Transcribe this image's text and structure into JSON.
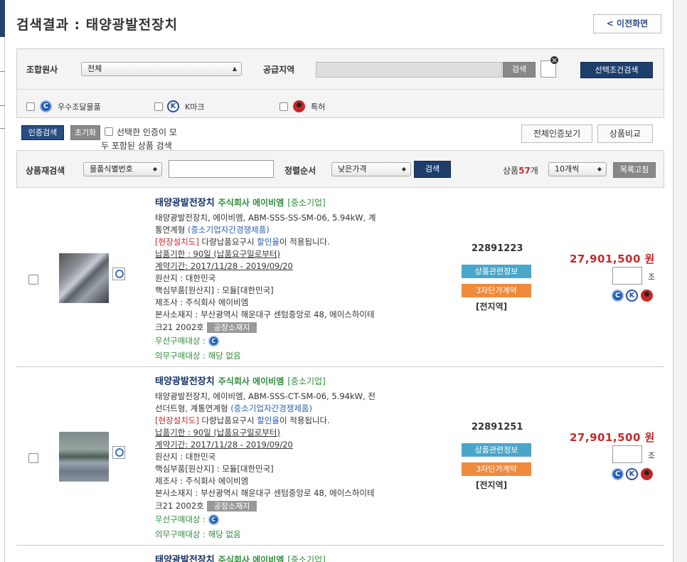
{
  "page": {
    "title": "검색결과 : 태양광발전장치",
    "back_label": "< 이전화면"
  },
  "filters": {
    "agency_label": "조합원사",
    "agency_value": "전체",
    "region_label": "공급지역",
    "search_label": "검색",
    "selected_search_label": "선택조건검색",
    "cert1": "우수조달물품",
    "cert2": "K마크",
    "cert3": "특허"
  },
  "cert_actions": {
    "cert_search": "인증검색",
    "reset": "초기화",
    "all_cert_line1": "선택한 인증이 모",
    "all_cert_line2": "두 포함된 상품 검색",
    "view_all_certs": "전체인증보기",
    "compare": "상품비교"
  },
  "research": {
    "label": "상품재검색",
    "field_value": "물품식별번호",
    "sort_label": "정렬순서",
    "sort_value": "낮은가격",
    "search_label": "검색",
    "count_prefix": "상품",
    "count": "57",
    "count_suffix": "개",
    "per_page": "10개씩",
    "list_refresh": "목록고침"
  },
  "products": [
    {
      "name": "태양광발전장치",
      "company": "주식회사 에이비엠",
      "size": "[중소기업]",
      "desc1": "태양광발전장치, 에이비엠, ABM-SSS-SS-SM-06, 5.94kW, 계",
      "desc2_a": "통연계형 ",
      "desc2_b": "(중소기업자간경쟁제품)",
      "note_a": "[현장설치도]",
      "note_b": " 다량납품요구시 ",
      "note_c": "할인율",
      "note_d": "이 적용됩니다.",
      "delivery": "납품기한 : 90일 (납품요구일로부터)",
      "contract": "계약기간: 2017/11/28 - 2019/09/20",
      "origin": "원산지 : 대한민국",
      "core": "핵심부품[원산지] : 모듈[대한민국]",
      "maker": "제조사 : 주식회사 에이비엠",
      "hq": "본사소재지 : 부산광역시 해운대구 센텀중앙로 48, 에이스하이테",
      "hq2": "크21 2002호",
      "factory": "공장소재지",
      "priority": "우선구매대상 :",
      "mandatory": "의무구매대상 : 해당 없음",
      "code": "22891223",
      "info_btn": "상품관련정보",
      "stage_btn": "3자단가계약",
      "area": "[전지역]",
      "price": "27,901,500 원",
      "unit": "조"
    },
    {
      "name": "태양광발전장치",
      "company": "주식회사 에이비엠",
      "size": "[중소기업]",
      "desc1": "태양광발전장치, 에이비엠, ABM-SSS-CT-SM-06, 5.94kW, 전",
      "desc2_a": "선더트형, 계통연계형 ",
      "desc2_b": "(중소기업자간경쟁제품)",
      "note_a": "[현장설치도]",
      "note_b": " 다량납품요구시 ",
      "note_c": "할인율",
      "note_d": "이 적용됩니다.",
      "delivery": "납품기한 : 90일 (납품요구일로부터)",
      "contract": "계약기간: 2017/11/28 - 2019/09/20",
      "origin": "원산지 : 대한민국",
      "core": "핵심부품[원산지] : 모듈[대한민국]",
      "maker": "제조사 : 주식회사 에이비엠",
      "hq": "본사소재지 : 부산광역시 해운대구 센텀중앙로 48, 에이스하이테",
      "hq2": "크21 2002호",
      "factory": "공장소재지",
      "priority": "우선구매대상 :",
      "mandatory": "의무구매대상 : 해당 없음",
      "code": "22891251",
      "info_btn": "상품관련정보",
      "stage_btn": "3자단가계약",
      "area": "[전지역]",
      "price": "27,901,500 원",
      "unit": "조"
    },
    {
      "name": "태양광발전장치",
      "company": "주식회사 에이비엠",
      "size": "[중소기업]"
    }
  ]
}
